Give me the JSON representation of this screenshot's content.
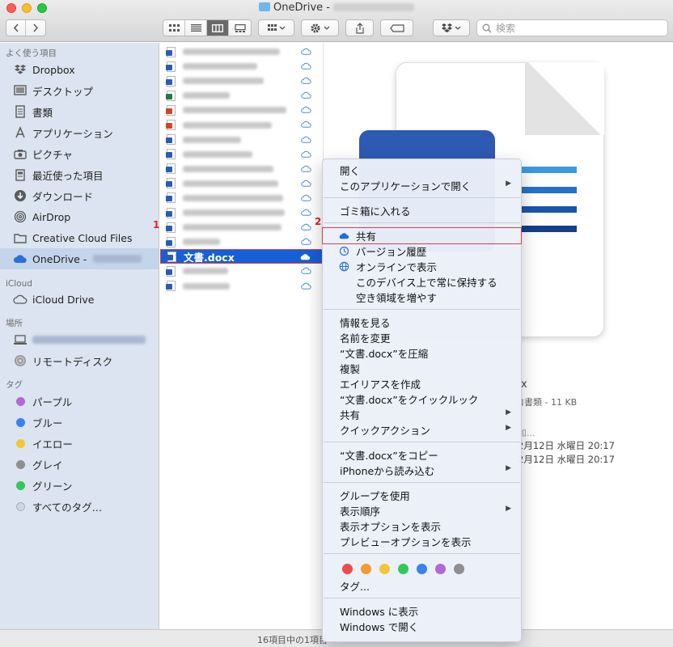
{
  "window": {
    "title": "OneDrive -"
  },
  "search": {
    "placeholder": "検索"
  },
  "sidebar": {
    "favorites_header": "よく使う項目",
    "favorites": [
      {
        "label": "Dropbox",
        "icon": "dropbox-icon"
      },
      {
        "label": "デスクトップ",
        "icon": "desktop-icon"
      },
      {
        "label": "書類",
        "icon": "documents-icon"
      },
      {
        "label": "アプリケーション",
        "icon": "applications-icon"
      },
      {
        "label": "ピクチャ",
        "icon": "camera-icon"
      },
      {
        "label": "最近使った項目",
        "icon": "recents-icon"
      },
      {
        "label": "ダウンロード",
        "icon": "download-icon"
      },
      {
        "label": "AirDrop",
        "icon": "airdrop-icon"
      },
      {
        "label": "Creative Cloud Files",
        "icon": "folder-icon"
      },
      {
        "label": "OneDrive -",
        "icon": "cloud-icon"
      }
    ],
    "icloud_header": "iCloud",
    "icloud_drive": "iCloud Drive",
    "places_header": "場所",
    "remote_disc": "リモートディスク",
    "tags_header": "タグ",
    "tags": [
      {
        "label": "パープル",
        "color": "#b467d8"
      },
      {
        "label": "ブルー",
        "color": "#3b82f0"
      },
      {
        "label": "イエロー",
        "color": "#f5c634"
      },
      {
        "label": "グレイ",
        "color": "#8e8e93"
      },
      {
        "label": "グリーン",
        "color": "#34c759"
      },
      {
        "label": "すべてのタグ…",
        "color": "#d0d6e0"
      }
    ]
  },
  "files": {
    "selected_name": "文書.docx",
    "badge_1": "1",
    "badge_2": "2"
  },
  "preview": {
    "name_tail": "x",
    "kind": "ロ書類 - 11 KB",
    "more": "加...",
    "created": "2月12日 水曜日 20:17",
    "modified": "2月12日 水曜日 20:17"
  },
  "status": {
    "text": "16項目中の1項目"
  },
  "context_menu": {
    "open": "開く",
    "open_with": "このアプリケーションで開く",
    "trash": "ゴミ箱に入れる",
    "share_onedrive": "共有",
    "version_history": "バージョン履歴",
    "view_online": "オンラインで表示",
    "always_keep": "このデバイス上で常に保持する",
    "free_space": "空き領域を増やす",
    "get_info": "情報を見る",
    "rename": "名前を変更",
    "compress": "“文書.docx”を圧縮",
    "duplicate": "複製",
    "make_alias": "エイリアスを作成",
    "quick_look": "“文書.docx”をクイックルック",
    "share": "共有",
    "quick_actions": "クイックアクション",
    "copy": "“文書.docx”をコピー",
    "import_iphone": "iPhoneから読み込む",
    "use_groups": "グループを使用",
    "sort_by": "表示順序",
    "view_options": "表示オプションを表示",
    "preview_options": "プレビューオプションを表示",
    "tag_colors": [
      "#ef4b4b",
      "#f59a31",
      "#f5c634",
      "#34c759",
      "#3b82f0",
      "#b467d8",
      "#8e8e93"
    ],
    "tags": "タグ...",
    "show_in_windows": "Windows に表示",
    "open_in_windows": "Windows で開く"
  }
}
